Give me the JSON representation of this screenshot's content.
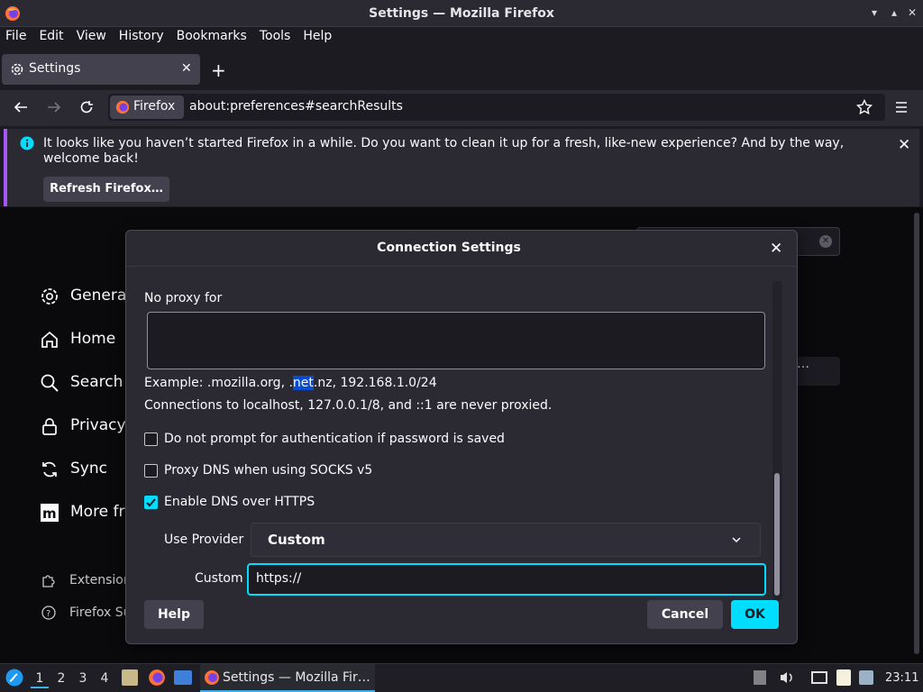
{
  "window": {
    "title": "Settings — Mozilla Firefox"
  },
  "menubar": {
    "items": [
      "File",
      "Edit",
      "View",
      "History",
      "Bookmarks",
      "Tools",
      "Help"
    ]
  },
  "tab": {
    "label": "Settings"
  },
  "urlbar": {
    "identity_label": "Firefox",
    "url": "about:preferences#searchResults"
  },
  "notification": {
    "message": "It looks like you haven’t started Firefox in a while. Do you want to clean it up for a fresh, like-new experience? And by the way, welcome back!",
    "button_label": "Refresh Firefox…"
  },
  "sidebar": {
    "items": [
      {
        "label": "General",
        "icon": "gear-icon"
      },
      {
        "label": "Home",
        "icon": "home-icon"
      },
      {
        "label": "Search",
        "icon": "search-icon"
      },
      {
        "label": "Privacy",
        "icon": "lock-icon"
      },
      {
        "label": "Sync",
        "icon": "sync-icon"
      },
      {
        "label": "More fro",
        "icon": "mozilla-icon"
      }
    ],
    "footer": [
      {
        "label": "Extension",
        "icon": "puzzle-icon"
      },
      {
        "label": "Firefox Su",
        "icon": "help-icon"
      }
    ]
  },
  "dialog": {
    "title": "Connection Settings",
    "no_proxy_label": "No proxy for",
    "no_proxy_value": "",
    "example_prefix": "Example: .mozilla.org, .",
    "example_highlight": "net",
    "example_suffix": ".nz, 192.168.1.0/24",
    "localhost_note": "Connections to localhost, 127.0.0.1/8, and ::1 are never proxied.",
    "checkboxes": [
      {
        "label": "Do not prompt for authentication if password is saved",
        "checked": false
      },
      {
        "label": "Proxy DNS when using SOCKS v5",
        "checked": false
      },
      {
        "label": "Enable DNS over HTTPS",
        "checked": true
      }
    ],
    "provider_label": "Use Provider",
    "provider_value": "Custom",
    "custom_label": "Custom",
    "custom_value": "https://",
    "help_label": "Help",
    "cancel_label": "Cancel",
    "ok_label": "OK"
  },
  "taskbar": {
    "workspaces": [
      "1",
      "2",
      "3",
      "4"
    ],
    "active_workspace": "1",
    "task_label": "Settings — Mozilla Fir…",
    "clock": "23:11"
  },
  "colors": {
    "accent": "#00ddff",
    "notification_bar": "#a855f7",
    "highlight": "#0a4bd2"
  }
}
